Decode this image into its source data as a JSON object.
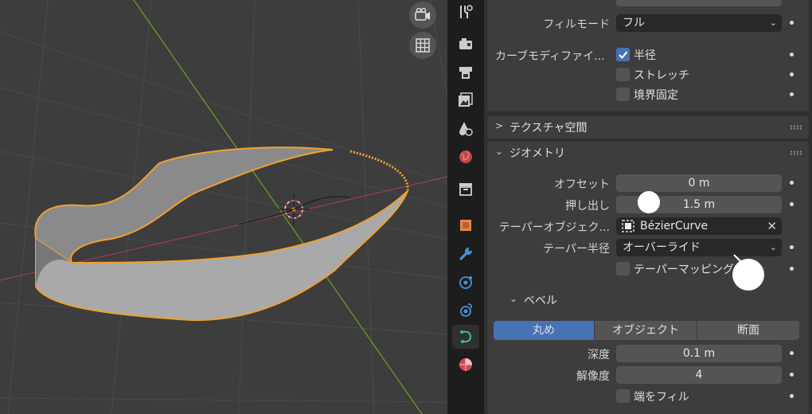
{
  "viewport": {
    "overlay_buttons": [
      {
        "name": "camera-view-icon"
      },
      {
        "name": "grid-perspective-icon"
      }
    ]
  },
  "property_tabs": [
    {
      "name": "tool-tab-icon",
      "glyph": "🔧",
      "active": false
    },
    {
      "name": "render-tab-icon",
      "glyph": "📷",
      "active": false
    },
    {
      "name": "output-tab-icon",
      "glyph": "🖨",
      "active": false
    },
    {
      "name": "view-layer-tab-icon",
      "glyph": "🖼",
      "active": false
    },
    {
      "name": "scene-tab-icon",
      "glyph": "◐",
      "active": false
    },
    {
      "name": "world-tab-icon",
      "glyph": "◉",
      "active": false
    },
    {
      "name": "collection-tab-icon",
      "glyph": "▤",
      "active": false
    },
    {
      "name": "object-tab-icon",
      "glyph": "■",
      "active": false
    },
    {
      "name": "modifier-tab-icon",
      "glyph": "🔧",
      "active": false
    },
    {
      "name": "particles-tab-icon",
      "glyph": "◎",
      "active": false
    },
    {
      "name": "physics-tab-icon",
      "glyph": "◍",
      "active": false
    },
    {
      "name": "curve-data-tab-icon",
      "glyph": "↶",
      "active": true
    },
    {
      "name": "material-tab-icon",
      "glyph": "◑",
      "active": false
    }
  ],
  "shape_panel": {
    "fill_mode_label": "フィルモード",
    "fill_mode_value": "フル",
    "curve_deform_label": "カーブモディファイ...",
    "radius_label": "半径",
    "stretch_label": "ストレッチ",
    "bounds_clamp_label": "境界固定"
  },
  "texture_space": {
    "title": "テクスチャ空間"
  },
  "geometry": {
    "title": "ジオメトリ",
    "offset_label": "オフセット",
    "offset_value": "0 m",
    "extrude_label": "押し出し",
    "extrude_value": "1.5 m",
    "taper_object_label": "テーパーオブジェク...",
    "taper_object_value": "BézierCurve",
    "taper_radius_label": "テーパー半径",
    "taper_radius_value": "オーバーライド",
    "taper_mapping_label": "テーパーマッピング"
  },
  "bevel": {
    "title": "ベベル",
    "modes": [
      "丸め",
      "オブジェクト",
      "断面"
    ],
    "active_mode": 0,
    "depth_label": "深度",
    "depth_value": "0.1 m",
    "resolution_label": "解像度",
    "resolution_value": "4",
    "fill_caps_label": "端をフィル"
  },
  "colors": {
    "accent": "#4772b3",
    "selection_outline": "#f0a030",
    "x_axis": "#a03c48",
    "y_axis": "#6a9a2c"
  }
}
